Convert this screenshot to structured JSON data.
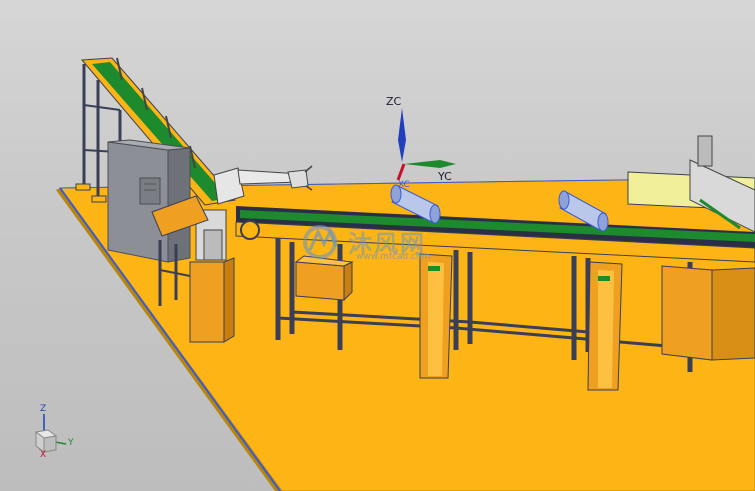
{
  "viewport": {
    "background": "#c9c9c9",
    "floor_color": "#fdb515",
    "frame_color": "#3a3f55",
    "belt_color": "#1e8a2e",
    "gray_color": "#8c8f95"
  },
  "wcs_labels": {
    "zc": "ZC",
    "yc": "YC",
    "xc": "XC"
  },
  "triad_labels": {
    "z": "Z",
    "y": "Y",
    "x": "X"
  },
  "watermark": {
    "text": "沐风网",
    "url": "www.mfcad.com",
    "icon": "mf-logo-icon"
  }
}
